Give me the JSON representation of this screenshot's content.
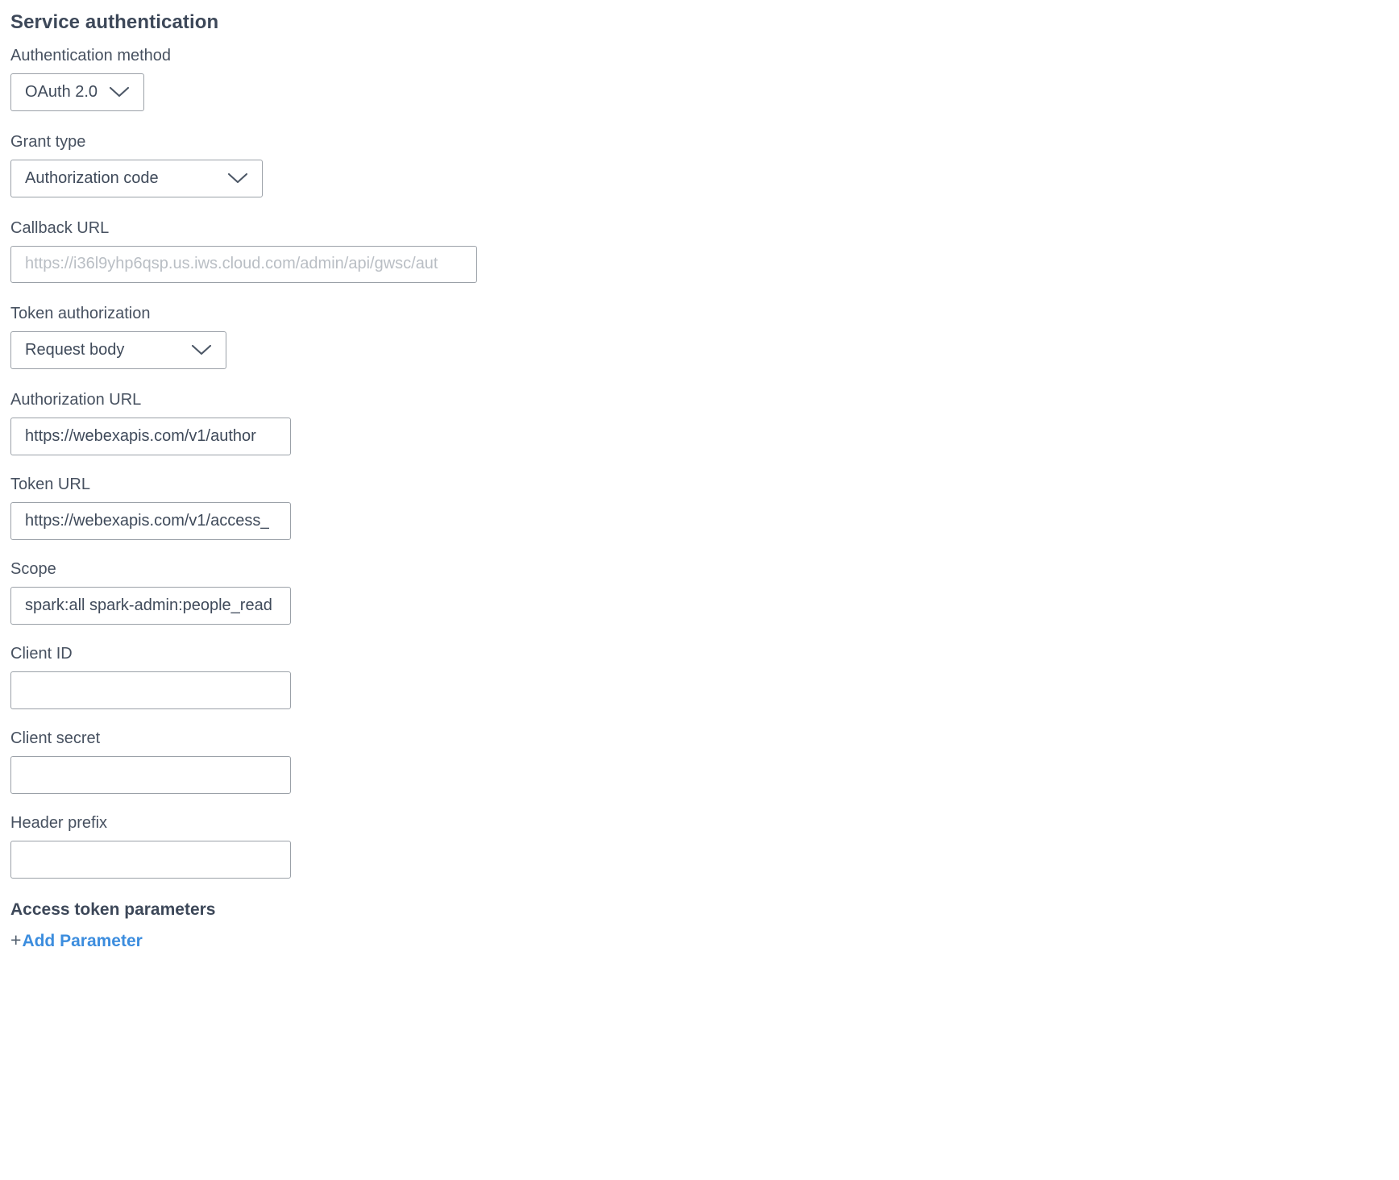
{
  "section": {
    "title": "Service authentication"
  },
  "fields": {
    "auth_method": {
      "label": "Authentication method",
      "value": "OAuth 2.0",
      "icon": "chevron-down-icon"
    },
    "grant_type": {
      "label": "Grant type",
      "value": "Authorization code",
      "icon": "chevron-down-icon"
    },
    "callback_url": {
      "label": "Callback URL",
      "value": "",
      "placeholder": "https://i36l9yhp6qsp.us.iws.cloud.com/admin/api/gwsc/aut"
    },
    "token_authorization": {
      "label": "Token authorization",
      "value": "Request body",
      "icon": "chevron-down-icon"
    },
    "authorization_url": {
      "label": "Authorization URL",
      "value": "https://webexapis.com/v1/author",
      "placeholder": ""
    },
    "token_url": {
      "label": "Token URL",
      "value": "https://webexapis.com/v1/access_",
      "placeholder": ""
    },
    "scope": {
      "label": "Scope",
      "value": "spark:all spark-admin:people_read",
      "placeholder": ""
    },
    "client_id": {
      "label": "Client ID",
      "value": "",
      "placeholder": ""
    },
    "client_secret": {
      "label": "Client secret",
      "value": "",
      "placeholder": ""
    },
    "header_prefix": {
      "label": "Header prefix",
      "value": "",
      "placeholder": ""
    }
  },
  "access_token_parameters": {
    "title": "Access token parameters",
    "add_plus": "+",
    "add_label": "Add Parameter"
  },
  "colors": {
    "heading": "#3d4859",
    "label": "#475160",
    "value_text": "#3f4a5a",
    "placeholder": "#b9bec4",
    "border": "#9ba1a8",
    "link": "#3c8dde",
    "plus": "#53606f",
    "background": "#ffffff"
  }
}
